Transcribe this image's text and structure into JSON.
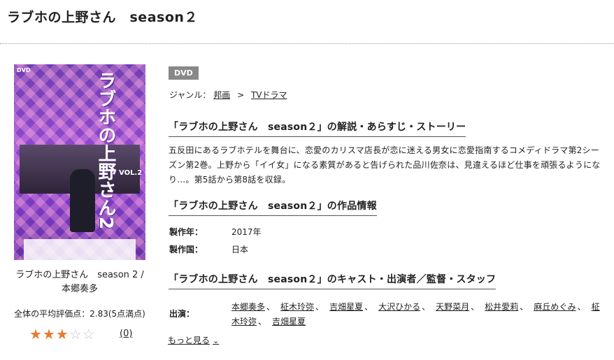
{
  "page_title": "ラブホの上野さん　season２",
  "cover": {
    "logo_text": "DVD",
    "title_text": "ラブホの上野さん2",
    "vol_text": "VOL.2"
  },
  "cover_caption": "ラブホの上野さん　season 2 / 本郷奏多",
  "rating": {
    "average_label": "全体の平均評価点：2.83(5点満点)",
    "score": 2.83,
    "max": 5,
    "stars_filled": 3,
    "review_count": "(0)"
  },
  "badge": "DVD",
  "genre": {
    "label": "ジャンル：",
    "items": [
      "邦画",
      "TVドラマ"
    ],
    "separator": ">"
  },
  "sections": {
    "synopsis_heading": "「ラブホの上野さん　season２」の解説・あらすじ・ストーリー",
    "synopsis_text": "五反田にあるラブホテルを舞台に、恋愛のカリスマ店長が恋に迷える男女に恋愛指南するコメディドラマ第2シーズン第2巻。上野から「イイ女」になる素質があると告げられた品川佐奈は、見違えるほど仕事を頑張るようになり…。第5話から第8話を収録。",
    "info_heading": "「ラブホの上野さん　season２」の作品情報",
    "cast_heading": "「ラブホの上野さん　season２」のキャスト・出演者／監督・スタッフ"
  },
  "info": {
    "year_label": "製作年：",
    "year_value": "2017年",
    "country_label": "製作国：",
    "country_value": "日本"
  },
  "cast": {
    "label": "出演：",
    "names": [
      "本郷奏多",
      "柾木玲弥",
      "吉畑星夏",
      "大沢ひかる",
      "天野菜月",
      "松井愛莉",
      "麻丘めぐみ",
      "柾木玲弥",
      "吉畑星夏"
    ],
    "separator": "、",
    "more_label": "もっと見る"
  },
  "colors": {
    "star_full": "#e87a2d",
    "star_empty": "#c8c8c8",
    "badge_bg": "#888888"
  }
}
